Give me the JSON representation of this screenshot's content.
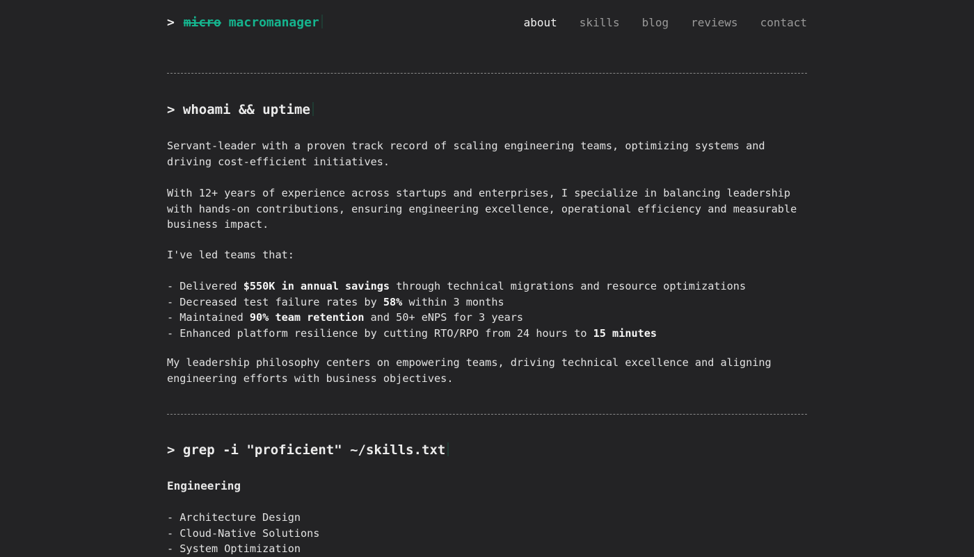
{
  "brand": {
    "prompt": ">",
    "strike_word": "micro",
    "rest": "macromanager"
  },
  "nav": [
    {
      "label": "about",
      "active": true
    },
    {
      "label": "skills",
      "active": false
    },
    {
      "label": "blog",
      "active": false
    },
    {
      "label": "reviews",
      "active": false
    },
    {
      "label": "contact",
      "active": false
    }
  ],
  "about": {
    "title": "> whoami && uptime",
    "p1": "Servant-leader with a proven track record of scaling engineering teams, optimizing systems and driving cost-efficient initiatives.",
    "p2": "With 12+ years of experience across startups and enterprises, I specialize in balancing leadership with hands-on contributions, ensuring engineering excellence, operational efficiency and measurable business impact.",
    "p3": "I've led teams that:",
    "achievements": [
      {
        "pre": "- Delivered ",
        "bold": "$550K in annual savings",
        "post": " through technical migrations and resource optimizations"
      },
      {
        "pre": "- Decreased test failure rates by ",
        "bold": "58%",
        "post": " within 3 months"
      },
      {
        "pre": "- Maintained ",
        "bold": "90% team retention",
        "post": " and 50+ eNPS for 3 years"
      },
      {
        "pre": "- Enhanced platform resilience by cutting RTO/RPO from 24 hours to ",
        "bold": "15 minutes",
        "post": ""
      }
    ],
    "p4": "My leadership philosophy centers on empowering teams, driving technical excellence and aligning engineering efforts with business objectives."
  },
  "skills": {
    "title": "> grep -i \"proficient\" ~/skills.txt",
    "subtitle": "Engineering",
    "items": [
      "- Architecture Design",
      "- Cloud-Native Solutions",
      "- System Optimization"
    ]
  },
  "colors": {
    "background": "#232325",
    "accent": "#15b58f",
    "text": "#e2e2e2",
    "nav_inactive": "#9a9a9a"
  }
}
